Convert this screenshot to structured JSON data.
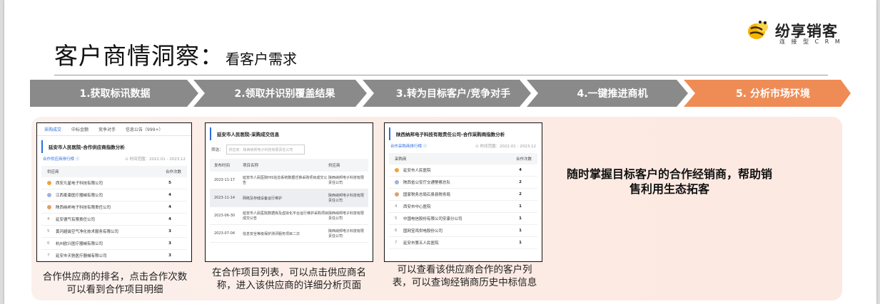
{
  "slide": {
    "title_main": "客户商情洞察：",
    "title_sub": "看客户需求",
    "brand_name": "纷享销客",
    "brand_sub": "连 接 型 C R M"
  },
  "steps": [
    {
      "label": "1.获取标讯数据",
      "color": "#8a8a8a"
    },
    {
      "label": "2.领取并识别覆盖结果",
      "color": "#8a8a8a"
    },
    {
      "label": "3.转为目标客户/竞争对手",
      "color": "#8a8a8a"
    },
    {
      "label": "4.一键推进商机",
      "color": "#8a8a8a"
    },
    {
      "label": "5. 分析市场环境",
      "color": "#ef8c55"
    }
  ],
  "shot1": {
    "tabs": [
      "采购成交",
      "中标金额",
      "竞争对手",
      "信息公告（999+）"
    ],
    "heading": "延安市人民医院-合作供应商指数分析",
    "rank_label": "合作供应商排行榜 ⓘ",
    "range_label": "⊙ 时间范围：2022.01 - 2023.12",
    "col_name": "供应商",
    "col_count": "合作次数",
    "rows": [
      {
        "name": "西安凡星电子科技有限公司",
        "count": "5",
        "medal": "#f0a33a"
      },
      {
        "name": "江西麦康医疗器械有限公司",
        "count": "4",
        "medal": "#9fb3d9"
      },
      {
        "name": "陕西纳邦电子科技有限责任公司",
        "count": "4",
        "medal": "#e0a06a"
      },
      {
        "name": "延安德气有限责任公司",
        "count": "4",
        "medal": ""
      },
      {
        "name": "黄河超级空气净化技术服务有限公司",
        "count": "3",
        "medal": ""
      },
      {
        "name": "杭州欧兴医疗器械有限公司",
        "count": "3",
        "medal": ""
      },
      {
        "name": "延安市天驰医疗器械有限公司",
        "count": "3",
        "medal": ""
      }
    ]
  },
  "shot2": {
    "heading": "延安市人民医院-采购成交信息",
    "search_label": "筛选：",
    "search_placeholder": "供应商：陕西纳邦电子科技有限责任公司",
    "col_date": "发布时间",
    "col_project": "项目名称",
    "col_supplier": "供应商",
    "rows": [
      {
        "date": "2023-11-17",
        "project": "延安市人民医院HIS信息系统数据迁移采购项目成交公告",
        "supplier": "陕西纳邦电子科技有限责任公司"
      },
      {
        "date": "2023-11-14",
        "project": "网络及存储设备运行维护",
        "supplier": "陕西纳邦电子科技有限责任公司"
      },
      {
        "date": "2023-06-30",
        "project": "延安市人民医院数据库及虚拟化平台运行维护采购项目成交公告",
        "supplier": "陕西纳邦电子科技有限责任公司"
      },
      {
        "date": "2023-07-04",
        "project": "信息安全等级保护测评服务项目二次",
        "supplier": "陕西纳邦电子科技有限责任公司"
      }
    ]
  },
  "shot3": {
    "heading": "陕西纳邦电子科技有限责任公司-合作采购商指数分析",
    "rank_label": "合作采购商排行榜 ⓘ",
    "range_label": "⊙ 时间范围：2022.01 - 2023.12",
    "col_name": "采购商",
    "col_count": "合作次数",
    "rows": [
      {
        "name": "延安市人民医院",
        "count": "4",
        "medal": "#f0a33a"
      },
      {
        "name": "陕西省公安厅交通警察总队",
        "count": "2",
        "medal": "#9fb3d9"
      },
      {
        "name": "国家税务总局石泉县税务局",
        "count": "2",
        "medal": "#e0a06a"
      },
      {
        "name": "西安市中心医院",
        "count": "1",
        "medal": "",
        "rank": "4"
      },
      {
        "name": "中国电信股份有限公司安康分公司",
        "count": "1",
        "medal": "",
        "rank": "5"
      },
      {
        "name": "国网宝鸡供电股份公司",
        "count": "1",
        "medal": "",
        "rank": "6"
      },
      {
        "name": "延安市第五人民医院",
        "count": "1",
        "medal": "",
        "rank": "7"
      }
    ]
  },
  "captions": {
    "cap1": "合作供应商的排名，点击合作次数可以看到合作项目明细",
    "cap2": "在合作项目列表，可以点击供应商名称，进入该供应商的详细分析页面",
    "cap3": "可以查看该供应商合作的客户列表，可以查询经销商历史中标信息",
    "claim": "随时掌握目标客户的合作经销商，帮助销售利用生态拓客"
  }
}
